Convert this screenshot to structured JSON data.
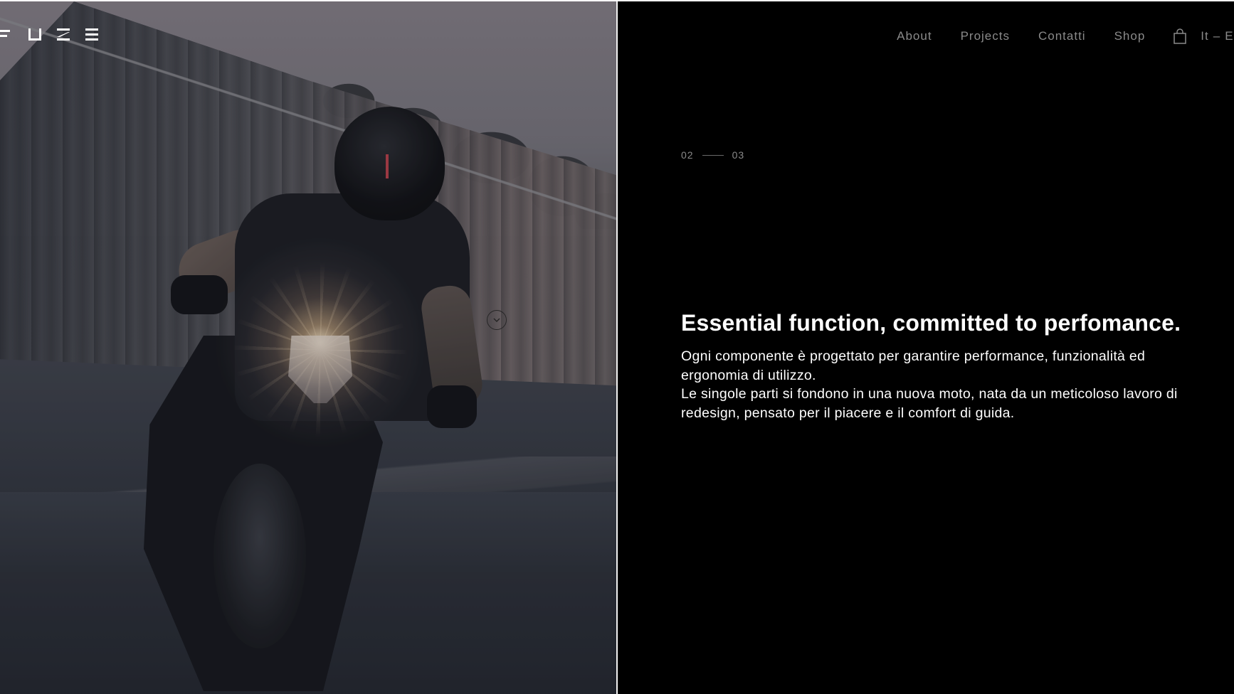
{
  "logo": {
    "name": "FUZE"
  },
  "nav": {
    "items": [
      {
        "label": "About"
      },
      {
        "label": "Projects"
      },
      {
        "label": "Contatti"
      },
      {
        "label": "Shop"
      }
    ],
    "lang": {
      "it": "It",
      "separator": "–",
      "en": "En"
    }
  },
  "slide": {
    "current": "02",
    "total": "03"
  },
  "content": {
    "headline": "Essential function, committed to perfomance.",
    "paragraph1": "Ogni componente è progettato per garantire performance, funzionalità ed ergonomia di utilizzo.",
    "paragraph2": "Le singole parti si fondono in una nuova moto, nata da un meticoloso lavoro di redesign, pensato per il piacere e il comfort di guida."
  },
  "icons": {
    "cart": "shopping-bag-icon",
    "scroll": "chevron-down-circle-icon"
  },
  "colors": {
    "background_right": "#000000",
    "text_primary": "#ffffff",
    "nav_text": "#8a8a8a"
  }
}
